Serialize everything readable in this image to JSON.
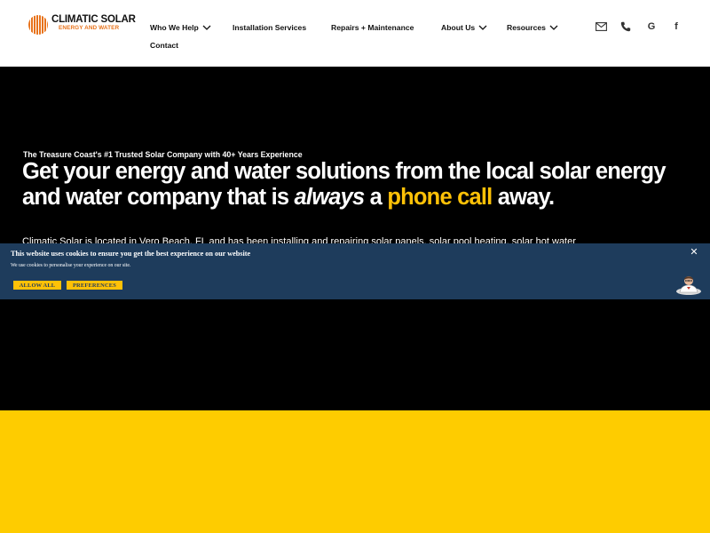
{
  "brand": {
    "name": "CLIMATIC SOLAR",
    "tagline": "ENERGY AND WATER",
    "accent": "#e8731c"
  },
  "nav": {
    "items": [
      {
        "label": "Who We Help",
        "dropdown": true
      },
      {
        "label": "Installation Services",
        "dropdown": false
      },
      {
        "label": "Repairs + Maintenance",
        "dropdown": false
      },
      {
        "label": "About Us",
        "dropdown": true
      },
      {
        "label": "Resources",
        "dropdown": true
      },
      {
        "label": "Contact",
        "dropdown": false
      }
    ],
    "icons": [
      "envelope-icon",
      "phone-icon",
      "google-icon",
      "facebook-icon"
    ]
  },
  "hero": {
    "kicker": "The Treasure Coast's #1 Trusted Solar Company with 40+ Years Experience",
    "headline_part1": "Get your energy and water solutions from the local solar energy and water company that is ",
    "headline_em": "always",
    "headline_part2": " a ",
    "headline_highlight": "phone call",
    "headline_part3": " away.",
    "lede": "Climatic Solar is located in Vero Beach, FL and has been installing and repairing solar panels, solar pool heating, solar hot water",
    "background": "#000000",
    "highlight_color": "#ffc107"
  },
  "section_color": "#fecc00",
  "cookie_banner": {
    "title": "This website uses cookies to ensure you get the best experience on our website",
    "text": "We use cookies to personalise your experience on our site.",
    "allow_label": "ALLOW ALL",
    "prefs_label": "PREFERENCES",
    "close_label": "✕",
    "background": "#1e3c5c",
    "button_color": "#ffc107"
  }
}
